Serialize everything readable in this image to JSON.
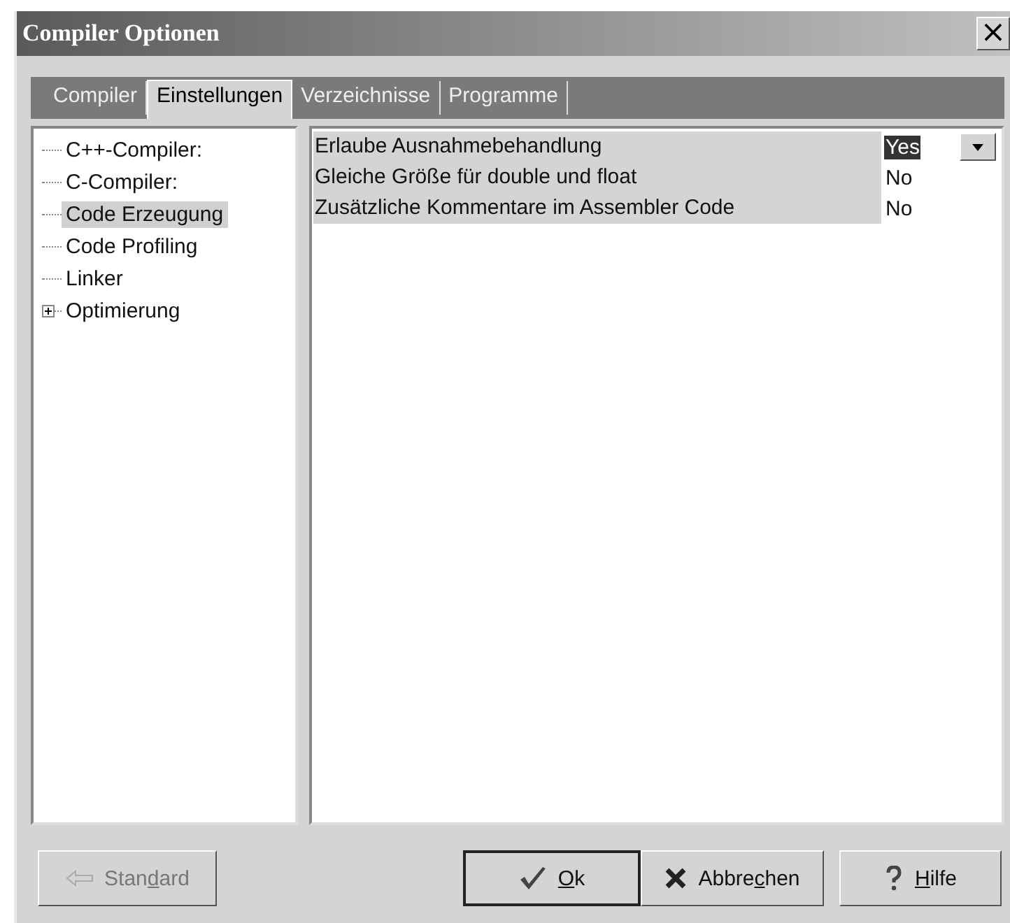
{
  "window": {
    "title": "Compiler Optionen",
    "close": "×"
  },
  "tabs": [
    {
      "label": "Compiler",
      "selected": false
    },
    {
      "label": "Einstellungen",
      "selected": true
    },
    {
      "label": "Verzeichnisse",
      "selected": false
    },
    {
      "label": "Programme",
      "selected": false
    }
  ],
  "tree": [
    {
      "label": "C++-Compiler:",
      "selected": false
    },
    {
      "label": "C-Compiler:",
      "selected": false
    },
    {
      "label": "Code Erzeugung",
      "selected": true
    },
    {
      "label": "Code Profiling",
      "selected": false
    },
    {
      "label": "Linker",
      "selected": false
    },
    {
      "label": "Optimierung",
      "selected": false,
      "expanded": false
    }
  ],
  "properties": [
    {
      "name": "Erlaube Ausnahmebehandlung",
      "value": "Yes",
      "selected": true
    },
    {
      "name": "Gleiche Größe für double und float",
      "value": "No",
      "selected": false
    },
    {
      "name": "Zusätzliche Kommentare im Assembler Code",
      "value": "No",
      "selected": false
    }
  ],
  "buttons": [
    {
      "kind": "back",
      "before": "Stan",
      "key": "d",
      "after": "ard",
      "disabled": true
    },
    {
      "kind": "ok",
      "key": "O",
      "after": "k",
      "disabled": false
    },
    {
      "kind": "cancel",
      "before": "Abbre",
      "key": "c",
      "after": "hen",
      "disabled": false
    },
    {
      "kind": "help",
      "key": "H",
      "after": "ilfe",
      "disabled": false
    }
  ]
}
